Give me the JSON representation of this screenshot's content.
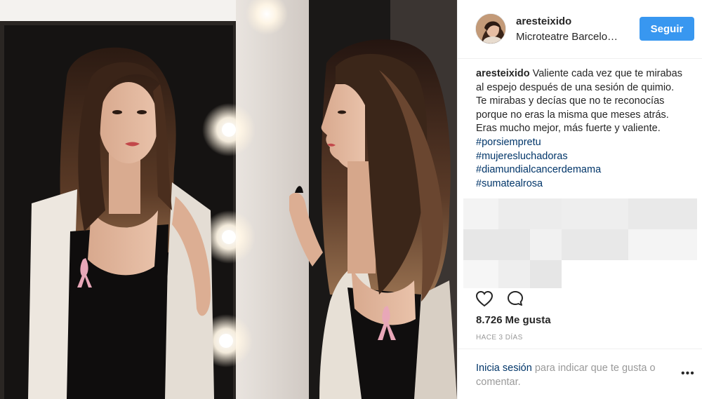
{
  "post": {
    "username": "aresteixido",
    "location": "Microteatre Barcelo…",
    "follow_label": "Seguir",
    "caption": {
      "username": "aresteixido",
      "text": "Valiente cada vez que te mirabas al espejo después de una sesión de quimio. Te mirabas y decías que no te reconocías porque no eras la misma que meses atrás. Eras mucho mejor, más fuerte y valiente.",
      "hashtags": [
        "#porsiempretu",
        "#mujeresluchadoras",
        "#diamundialcancerdemama",
        "#sumatealrosa"
      ]
    },
    "likes_count": "8.726",
    "likes_label": "Me gusta",
    "timestamp": "HACE 3 DÍAS",
    "login_prompt": {
      "link": "Inicia sesión",
      "text": "para indicar que te gusta o comentar."
    },
    "more_label": "•••"
  },
  "icons": {
    "like": "heart-outline-icon",
    "comment": "speech-bubble-icon",
    "more": "ellipsis-icon"
  },
  "colors": {
    "follow_button": "#3897f0",
    "hashtag": "#003569",
    "primary_text": "#262626",
    "secondary_text": "#999999",
    "border": "#efefef"
  }
}
